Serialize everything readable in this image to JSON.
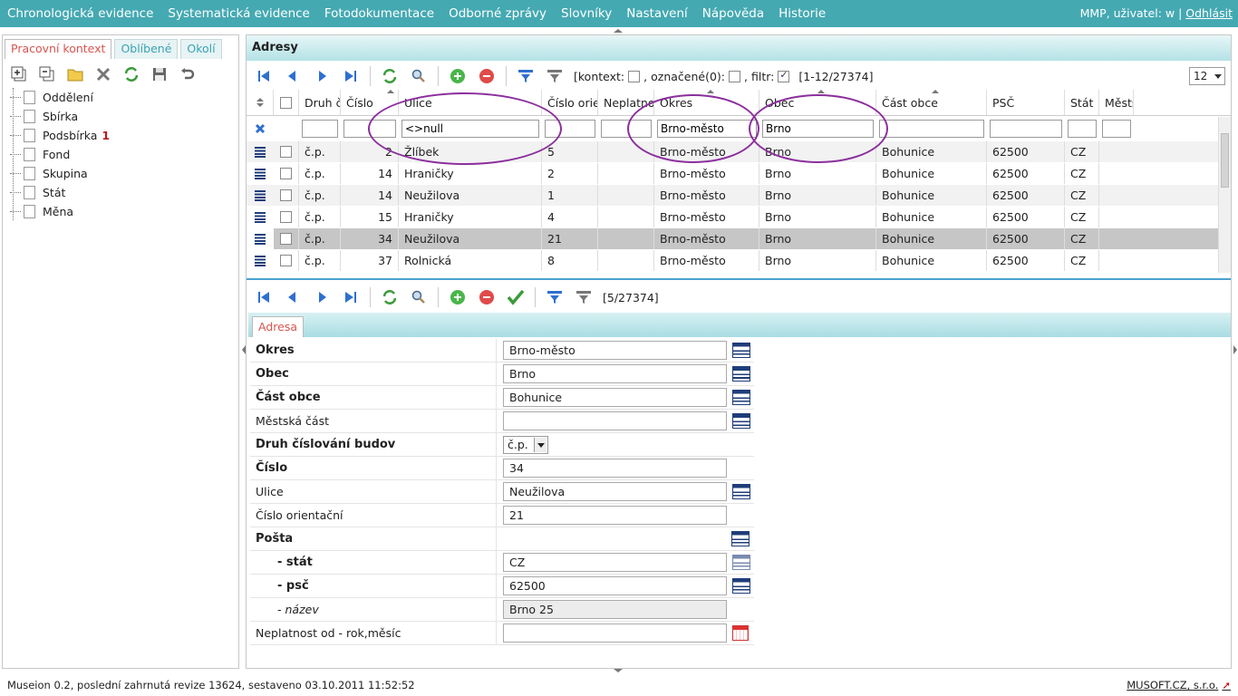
{
  "menu": {
    "items": [
      "Chronologická evidence",
      "Systematická evidence",
      "Fotodokumentace",
      "Odborné zprávy",
      "Slovníky",
      "Nastavení",
      "Nápověda",
      "Historie"
    ],
    "user_text": "MMP, uživatel: w |",
    "logout": "Odhlásit"
  },
  "left": {
    "tabs": [
      "Pracovní kontext",
      "Oblíbené",
      "Okolí"
    ],
    "tree": [
      {
        "label": "Oddělení",
        "badge": ""
      },
      {
        "label": "Sbírka",
        "badge": ""
      },
      {
        "label": "Podsbírka",
        "badge": "1"
      },
      {
        "label": "Fond",
        "badge": ""
      },
      {
        "label": "Skupina",
        "badge": ""
      },
      {
        "label": "Stát",
        "badge": ""
      },
      {
        "label": "Měna",
        "badge": ""
      }
    ]
  },
  "list": {
    "title": "Adresy",
    "kontext_label": "[kontext:",
    "oznacene_label": "označené(0):",
    "filtr_label": "filtr:",
    "range": "[1-12/27374]",
    "page_size": "12",
    "columns": [
      "Druh č",
      "Číslo",
      "Ulice",
      "Číslo orie",
      "Neplatno",
      "Okres",
      "Obec",
      "Část obce",
      "PSČ",
      "Stát",
      "Městs"
    ],
    "filters": {
      "ulice": "<>null",
      "okres": "Brno-město",
      "obec": "Brno"
    },
    "rows": [
      {
        "druh": "č.p.",
        "cislo": "2",
        "ulice": "Žlíbek",
        "orient": "5",
        "neplatno": "",
        "okres": "Brno-město",
        "obec": "Brno",
        "cast": "Bohunice",
        "psc": "62500",
        "stat": "CZ"
      },
      {
        "druh": "č.p.",
        "cislo": "14",
        "ulice": "Hraničky",
        "orient": "2",
        "neplatno": "",
        "okres": "Brno-město",
        "obec": "Brno",
        "cast": "Bohunice",
        "psc": "62500",
        "stat": "CZ"
      },
      {
        "druh": "č.p.",
        "cislo": "14",
        "ulice": "Neužilova",
        "orient": "1",
        "neplatno": "",
        "okres": "Brno-město",
        "obec": "Brno",
        "cast": "Bohunice",
        "psc": "62500",
        "stat": "CZ"
      },
      {
        "druh": "č.p.",
        "cislo": "15",
        "ulice": "Hraničky",
        "orient": "4",
        "neplatno": "",
        "okres": "Brno-město",
        "obec": "Brno",
        "cast": "Bohunice",
        "psc": "62500",
        "stat": "CZ"
      },
      {
        "druh": "č.p.",
        "cislo": "34",
        "ulice": "Neužilova",
        "orient": "21",
        "neplatno": "",
        "okres": "Brno-město",
        "obec": "Brno",
        "cast": "Bohunice",
        "psc": "62500",
        "stat": "CZ"
      },
      {
        "druh": "č.p.",
        "cislo": "37",
        "ulice": "Rolnická",
        "orient": "8",
        "neplatno": "",
        "okres": "Brno-město",
        "obec": "Brno",
        "cast": "Bohunice",
        "psc": "62500",
        "stat": "CZ"
      }
    ]
  },
  "detail": {
    "position": "[5/27374]",
    "tab": "Adresa",
    "fields": [
      {
        "label": "Okres",
        "value": "Brno-město"
      },
      {
        "label": "Obec",
        "value": "Brno"
      },
      {
        "label": "Část obce",
        "value": "Bohunice"
      },
      {
        "label": "Městská část",
        "value": ""
      },
      {
        "label": "Druh číslování budov",
        "value": "č.p."
      },
      {
        "label": "Číslo",
        "value": "34"
      },
      {
        "label": "Ulice",
        "value": "Neužilova"
      },
      {
        "label": "Číslo orientační",
        "value": "21"
      },
      {
        "label": "Pošta",
        "value": ""
      },
      {
        "label": "- stát",
        "value": "CZ"
      },
      {
        "label": "- psč",
        "value": "62500"
      },
      {
        "label": "- název",
        "value": "Brno 25"
      },
      {
        "label": "Neplatnost od - rok,měsíc",
        "value": ""
      }
    ]
  },
  "status": {
    "text": "Museion 0.2, poslední zahrnutá revize 13624, sestaveno 03.10.2011 11:52:52",
    "vendor": "MUSOFT.CZ, s.r.o."
  },
  "colors": {
    "accent": "#45a9b2",
    "annotation": "#8b2f9c"
  }
}
